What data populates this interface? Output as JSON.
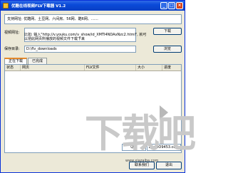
{
  "window": {
    "title": "优酷在线视频FLV下载器 V1.2"
  },
  "support_text": "支持网址: 优酷网、土豆网、六间房、56网、酷6网、……",
  "url_row": {
    "label": "视频网址:",
    "hint": "比如: 输入\"http://v.youku.com/v_show/id_XMTI4NDAxNzc2.html\", 就可以把此网页所播放的视频文件下载下来",
    "button": "下载"
  },
  "dir_row": {
    "label": "保存目录:",
    "value": "D:\\flv_downloads",
    "button": "浏览"
  },
  "tabs": [
    {
      "label": "正在下载"
    },
    {
      "label": "已完成"
    }
  ],
  "table": {
    "headers": [
      "状态",
      "网页",
      "FLV文件",
      "大小",
      "进度"
    ]
  },
  "footer": {
    "qq": "QQ: ",
    "site": "ZiraDO9453.com",
    "contact_button": "联系我们",
    "exit_button": "退出"
  },
  "watermark": {
    "text": "下载吧",
    "url": "www.xiazaiba.com"
  },
  "colors": {
    "titlebar": "#0a4ad8",
    "window_bg": "#ece9d8",
    "active_tab_accent": "#e68b2c"
  }
}
